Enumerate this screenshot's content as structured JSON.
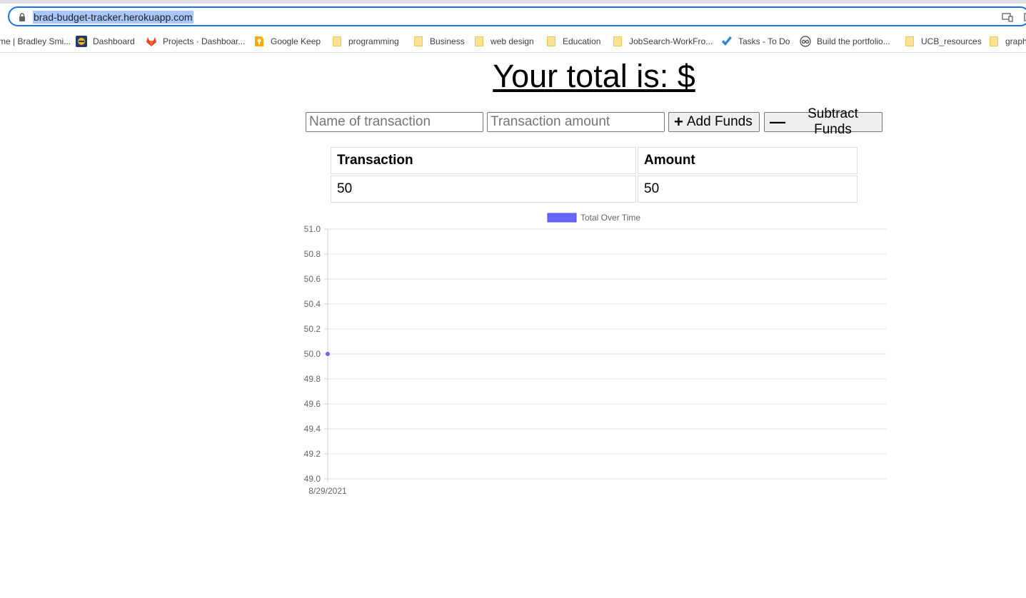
{
  "browser": {
    "url": "brad-budget-tracker.herokuapp.com",
    "bookmarks": [
      {
        "label": "me | Bradley Smi...",
        "icon": "none"
      },
      {
        "label": "Dashboard",
        "icon": "dashboard-icon"
      },
      {
        "label": "Projects · Dashboar...",
        "icon": "gitlab-icon"
      },
      {
        "label": "Google Keep",
        "icon": "google-keep-icon"
      },
      {
        "label": "programming",
        "icon": "folder-icon"
      },
      {
        "label": "Business",
        "icon": "folder-icon"
      },
      {
        "label": "web design",
        "icon": "folder-icon"
      },
      {
        "label": "Education",
        "icon": "folder-icon"
      },
      {
        "label": "JobSearch-WorkFro...",
        "icon": "folder-icon"
      },
      {
        "label": "Tasks - To Do",
        "icon": "checkmark-icon"
      },
      {
        "label": "Build the portfolio...",
        "icon": "glasses-icon"
      },
      {
        "label": "UCB_resources",
        "icon": "folder-icon"
      },
      {
        "label": "graph",
        "icon": "folder-icon"
      }
    ]
  },
  "page": {
    "title": "Your total is: $",
    "name_placeholder": "Name of transaction",
    "amount_placeholder": "Transaction amount",
    "add_label": "Add Funds",
    "subtract_label": "Subtract Funds"
  },
  "table": {
    "headers": [
      "Transaction",
      "Amount"
    ],
    "rows": [
      [
        "50",
        "50"
      ]
    ]
  },
  "chart_data": {
    "type": "line",
    "series": [
      {
        "name": "Total Over Time",
        "x": [
          "8/29/2021"
        ],
        "values": [
          50
        ]
      }
    ],
    "categories": [
      "8/29/2021"
    ],
    "ylim": [
      49.0,
      51.0
    ],
    "yticks": [
      "51.0",
      "50.8",
      "50.6",
      "50.4",
      "50.2",
      "50.0",
      "49.8",
      "49.6",
      "49.4",
      "49.2",
      "49.0"
    ],
    "grid": true,
    "legend": "top-center",
    "color": "#6666ff"
  }
}
